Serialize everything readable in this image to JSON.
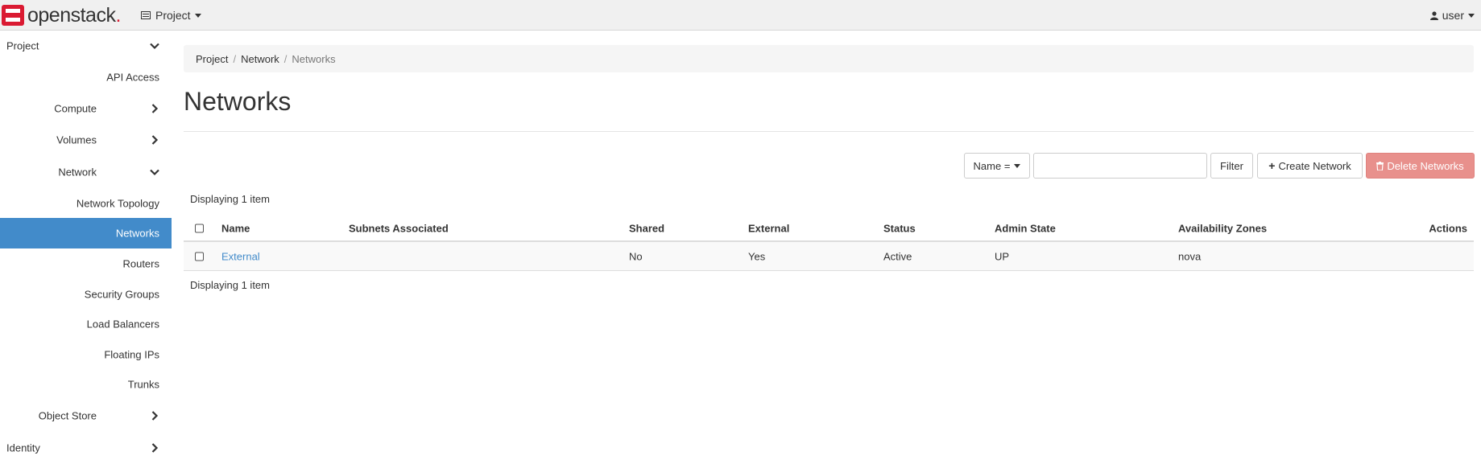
{
  "navbar": {
    "brand": "openstack",
    "brand_dot": ".",
    "project_label": "Project",
    "user_label": "user"
  },
  "sidebar": {
    "items": [
      {
        "label": "Project"
      },
      {
        "label": "API Access"
      },
      {
        "label": "Compute"
      },
      {
        "label": "Volumes"
      },
      {
        "label": "Network"
      },
      {
        "label": "Network Topology"
      },
      {
        "label": "Networks"
      },
      {
        "label": "Routers"
      },
      {
        "label": "Security Groups"
      },
      {
        "label": "Load Balancers"
      },
      {
        "label": "Floating IPs"
      },
      {
        "label": "Trunks"
      },
      {
        "label": "Object Store"
      },
      {
        "label": "Identity"
      }
    ]
  },
  "breadcrumb": {
    "items": [
      "Project",
      "Network"
    ],
    "current": "Networks",
    "separator": "/"
  },
  "page": {
    "title": "Networks"
  },
  "toolbar": {
    "filter_field": "Name =",
    "filter_value": "",
    "filter_button": "Filter",
    "create_button": "Create Network",
    "delete_button": "Delete Networks"
  },
  "table": {
    "count_text": "Displaying 1 item",
    "columns": [
      "Name",
      "Subnets Associated",
      "Shared",
      "External",
      "Status",
      "Admin State",
      "Availability Zones",
      "Actions"
    ],
    "rows": [
      {
        "name": "External",
        "subnets": "",
        "shared": "No",
        "external": "Yes",
        "status": "Active",
        "admin_state": "UP",
        "zones": "nova",
        "actions": ""
      }
    ]
  },
  "colors": {
    "accent": "#428bca",
    "brand_red": "#da1a32",
    "danger_disabled": "#e8908c"
  }
}
